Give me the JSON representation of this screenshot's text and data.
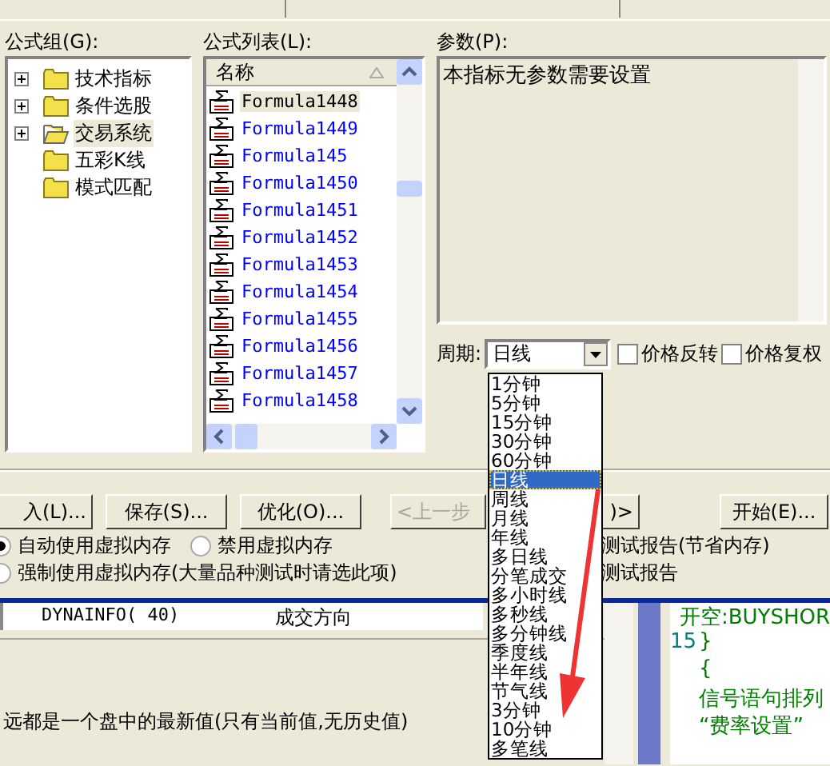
{
  "formula_groups": {
    "label": "公式组(G):",
    "items": [
      {
        "label": "技术指标",
        "expandable": true,
        "open": false,
        "selected": false
      },
      {
        "label": "条件选股",
        "expandable": true,
        "open": false,
        "selected": false
      },
      {
        "label": "交易系统",
        "expandable": true,
        "open": true,
        "selected": true
      },
      {
        "label": "五彩K线",
        "expandable": false,
        "open": false,
        "selected": false
      },
      {
        "label": "模式匹配",
        "expandable": false,
        "open": false,
        "selected": false
      }
    ]
  },
  "formula_list": {
    "label": "公式列表(L):",
    "column": "名称",
    "items": [
      {
        "name": "Formula1448",
        "selected": true
      },
      {
        "name": "Formula1449",
        "selected": false
      },
      {
        "name": "Formula145",
        "selected": false
      },
      {
        "name": "Formula1450",
        "selected": false
      },
      {
        "name": "Formula1451",
        "selected": false
      },
      {
        "name": "Formula1452",
        "selected": false
      },
      {
        "name": "Formula1453",
        "selected": false
      },
      {
        "name": "Formula1454",
        "selected": false
      },
      {
        "name": "Formula1455",
        "selected": false
      },
      {
        "name": "Formula1456",
        "selected": false
      },
      {
        "name": "Formula1457",
        "selected": false
      },
      {
        "name": "Formula1458",
        "selected": false
      }
    ]
  },
  "parameters": {
    "label": "参数(P):",
    "text": "本指标无参数需要设置"
  },
  "period": {
    "label": "周期:",
    "value": "日线",
    "options": [
      {
        "label": "1分钟",
        "selected": false
      },
      {
        "label": "5分钟",
        "selected": false
      },
      {
        "label": "15分钟",
        "selected": false
      },
      {
        "label": "30分钟",
        "selected": false
      },
      {
        "label": "60分钟",
        "selected": false
      },
      {
        "label": "日线",
        "selected": true
      },
      {
        "label": "周线",
        "selected": false
      },
      {
        "label": "月线",
        "selected": false
      },
      {
        "label": "年线",
        "selected": false
      },
      {
        "label": "多日线",
        "selected": false
      },
      {
        "label": "分笔成交",
        "selected": false
      },
      {
        "label": "多小时线",
        "selected": false
      },
      {
        "label": "多秒线",
        "selected": false
      },
      {
        "label": "多分钟线",
        "selected": false
      },
      {
        "label": "季度线",
        "selected": false
      },
      {
        "label": "半年线",
        "selected": false
      },
      {
        "label": "节气线",
        "selected": false
      },
      {
        "label": "3分钟",
        "selected": false
      },
      {
        "label": "10分钟",
        "selected": false
      },
      {
        "label": "多笔线",
        "selected": false
      }
    ]
  },
  "checkboxes": [
    {
      "label": "价格反转",
      "checked": false
    },
    {
      "label": "价格复权",
      "checked": false
    }
  ],
  "buttons": [
    {
      "label": "入(L)...",
      "disabled": false
    },
    {
      "label": "保存(S)...",
      "disabled": false
    },
    {
      "label": "优化(O)...",
      "disabled": false
    },
    {
      "label": "<上一步",
      "disabled": true
    },
    {
      "label": ")>",
      "disabled": false
    },
    {
      "label": "开始(E)...",
      "disabled": false
    }
  ],
  "memory_options": [
    {
      "label": "自动使用虚拟内存",
      "selected": true
    },
    {
      "label": "禁用虚拟内存",
      "selected": false
    },
    {
      "label": "强制使用虚拟内存(大量品种测试时请选此项)",
      "selected": false
    }
  ],
  "report_options": [
    "测试报告(节省内存)",
    "测试报告"
  ],
  "variables": [
    {
      "name": "DYNAINFO( 40)",
      "description": "成交方向"
    }
  ],
  "note": "远都是一个盘中的最新值(只有当前值,无历史值)",
  "code": [
    {
      "text": "开空:BUYSHOR"
    },
    {
      "line_no": "15",
      "text": "}"
    },
    {
      "text": "{"
    },
    {
      "text": "信号语句排列"
    },
    {
      "text": "“费率设置”"
    }
  ]
}
